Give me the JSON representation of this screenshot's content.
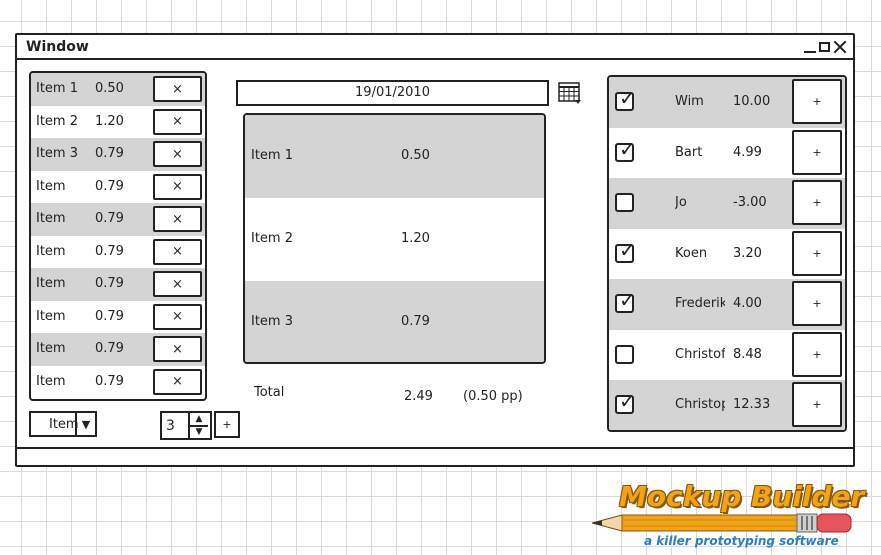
{
  "window": {
    "title": "Window"
  },
  "left_list": {
    "button_label": "×",
    "items": [
      {
        "name": "Item 1",
        "value": "0.50"
      },
      {
        "name": "Item 2",
        "value": "1.20"
      },
      {
        "name": "Item 3",
        "value": "0.79"
      },
      {
        "name": "Item",
        "value": "0.79"
      },
      {
        "name": "Item",
        "value": "0.79"
      },
      {
        "name": "Item",
        "value": "0.79"
      },
      {
        "name": "Item",
        "value": "0.79"
      },
      {
        "name": "Item",
        "value": "0.79"
      },
      {
        "name": "Item",
        "value": "0.79"
      },
      {
        "name": "Item",
        "value": "0.79"
      }
    ]
  },
  "controls": {
    "dropdown_value": "Item",
    "dropdown_arrow": "▼",
    "stepper_value": "3",
    "stepper_up": "▲",
    "stepper_down": "▼",
    "add_label": "+"
  },
  "date": {
    "value": "19/01/2010",
    "icon": "calendar-icon"
  },
  "center_table": {
    "rows": [
      {
        "name": "Item 1",
        "value": "0.50"
      },
      {
        "name": "Item 2",
        "value": "1.20"
      },
      {
        "name": "Item 3",
        "value": "0.79"
      }
    ]
  },
  "totals": {
    "label": "Total",
    "value": "2.49",
    "per_person": "(0.50 pp)"
  },
  "right_list": {
    "button_label": "+",
    "people": [
      {
        "name": "Wim",
        "value": "10.00",
        "checked": true
      },
      {
        "name": "Bart",
        "value": "4.99",
        "checked": true
      },
      {
        "name": "Jo",
        "value": "-3.00",
        "checked": false
      },
      {
        "name": "Koen",
        "value": "3.20",
        "checked": true
      },
      {
        "name": "Frederik",
        "value": "4.00",
        "checked": true
      },
      {
        "name": "Christof",
        "value": "8.48",
        "checked": false
      },
      {
        "name": "Christoph",
        "value": "12.33",
        "checked": true
      }
    ]
  },
  "logo": {
    "title": "Mockup Builder",
    "tagline": "a killer prototyping software"
  },
  "colors": {
    "row_shade": "#d4d4d4",
    "logo_orange": "#f2a317",
    "logo_blue": "#2a7cc8"
  }
}
